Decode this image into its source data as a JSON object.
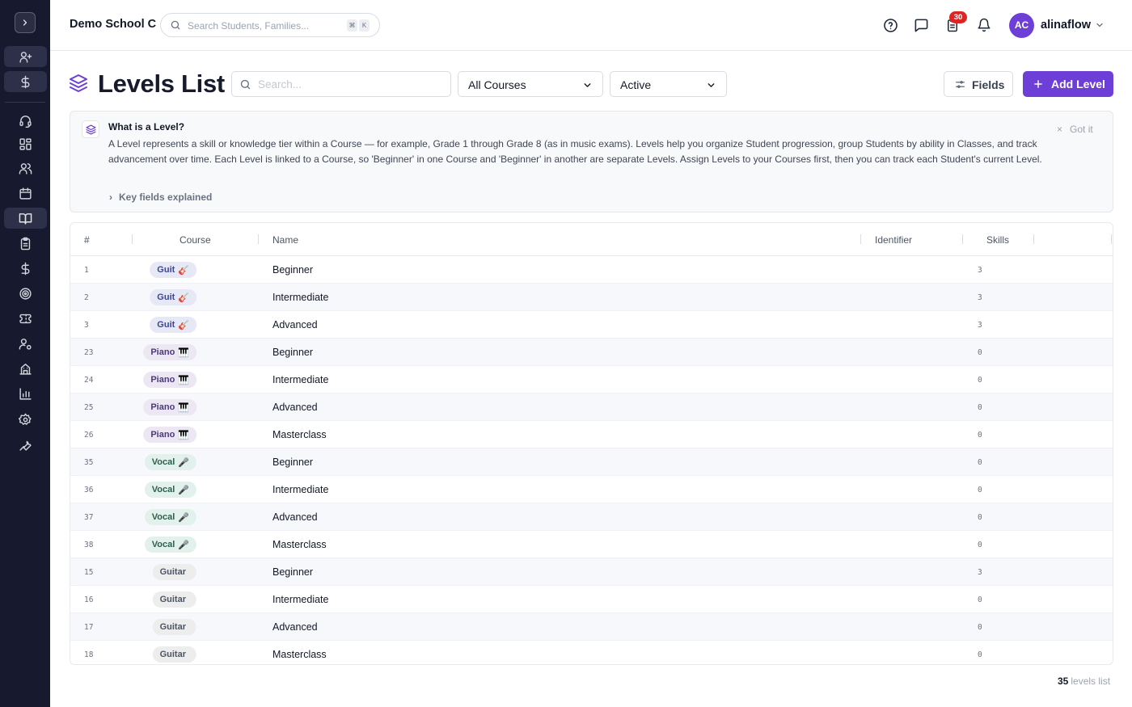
{
  "header": {
    "school_name": "Demo School C",
    "search_placeholder": "Search Students, Families...",
    "shortcut_keys": [
      "⌘",
      "K"
    ],
    "tasks_badge": "30",
    "avatar_initials": "AC",
    "username": "alinaflow"
  },
  "sidebar": {
    "items": [
      "add-user",
      "billing",
      "support",
      "dashboard",
      "students",
      "calendar",
      "courses",
      "tasks",
      "finance",
      "goals",
      "tickets",
      "staff",
      "buildings",
      "reports",
      "settings",
      "tools"
    ],
    "active": "courses"
  },
  "page": {
    "title": "Levels List",
    "search_placeholder": "Search...",
    "course_filter": "All Courses",
    "status_filter": "Active",
    "fields_label": "Fields",
    "add_label": "Add Level"
  },
  "info": {
    "title": "What is a Level?",
    "body": "A Level represents a skill or knowledge tier within a Course — for example, Grade 1 through Grade 8 (as in music exams). Levels help you organize Student progression, group Students by ability in Classes, and track advancement over time. Each Level is linked to a Course, so 'Beginner' in one Course and 'Beginner' in another are separate Levels. Assign Levels to your Courses first, then you can track each Student's current Level.",
    "key_fields": "Key fields explained",
    "dismiss": "Got it"
  },
  "table": {
    "columns": [
      "#",
      "Course",
      "Name",
      "Identifier",
      "Skills"
    ],
    "rows": [
      {
        "num": "1",
        "course": "Guit",
        "emoji": "🎸",
        "style": "guit",
        "name": "Beginner",
        "skills": "3"
      },
      {
        "num": "2",
        "course": "Guit",
        "emoji": "🎸",
        "style": "guit",
        "name": "Intermediate",
        "skills": "3"
      },
      {
        "num": "3",
        "course": "Guit",
        "emoji": "🎸",
        "style": "guit",
        "name": "Advanced",
        "skills": "3"
      },
      {
        "num": "23",
        "course": "Piano",
        "emoji": "🎹",
        "style": "piano",
        "name": "Beginner",
        "skills": "0"
      },
      {
        "num": "24",
        "course": "Piano",
        "emoji": "🎹",
        "style": "piano",
        "name": "Intermediate",
        "skills": "0"
      },
      {
        "num": "25",
        "course": "Piano",
        "emoji": "🎹",
        "style": "piano",
        "name": "Advanced",
        "skills": "0"
      },
      {
        "num": "26",
        "course": "Piano",
        "emoji": "🎹",
        "style": "piano",
        "name": "Masterclass",
        "skills": "0"
      },
      {
        "num": "35",
        "course": "Vocal",
        "emoji": "🎤",
        "style": "vocal",
        "name": "Beginner",
        "skills": "0"
      },
      {
        "num": "36",
        "course": "Vocal",
        "emoji": "🎤",
        "style": "vocal",
        "name": "Intermediate",
        "skills": "0"
      },
      {
        "num": "37",
        "course": "Vocal",
        "emoji": "🎤",
        "style": "vocal",
        "name": "Advanced",
        "skills": "0"
      },
      {
        "num": "38",
        "course": "Vocal",
        "emoji": "🎤",
        "style": "vocal",
        "name": "Masterclass",
        "skills": "0"
      },
      {
        "num": "15",
        "course": "Guitar",
        "emoji": "",
        "style": "guitar",
        "name": "Beginner",
        "skills": "3"
      },
      {
        "num": "16",
        "course": "Guitar",
        "emoji": "",
        "style": "guitar",
        "name": "Intermediate",
        "skills": "0"
      },
      {
        "num": "17",
        "course": "Guitar",
        "emoji": "",
        "style": "guitar",
        "name": "Advanced",
        "skills": "0"
      },
      {
        "num": "18",
        "course": "Guitar",
        "emoji": "",
        "style": "guitar",
        "name": "Masterclass",
        "skills": "0"
      }
    ]
  },
  "footer": {
    "count": "35",
    "label": "levels list"
  },
  "colors": {
    "sidebar_bg": "#171a2e",
    "accent": "#6d3fd6",
    "badge": "#dc2626"
  }
}
